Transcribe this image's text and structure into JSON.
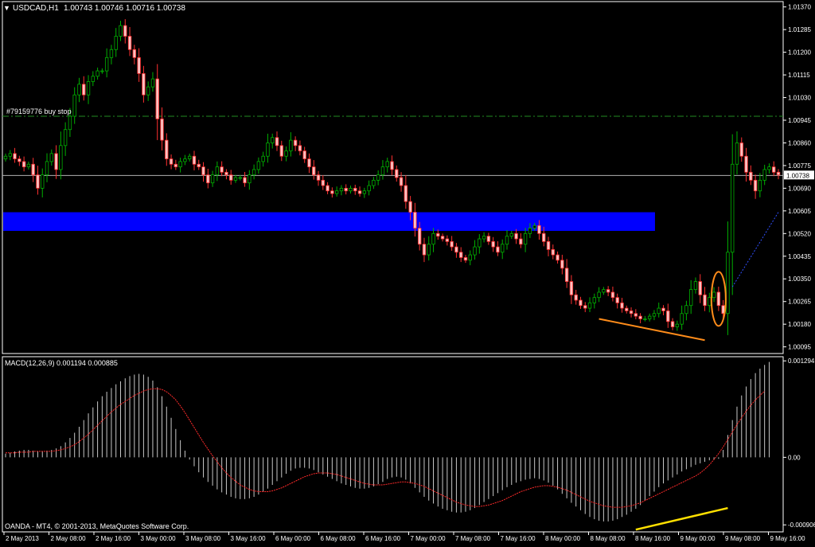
{
  "colors": {
    "background": "#000000",
    "frame": "#ffffff",
    "bull": "#00b000",
    "bear": "#ffc0c0",
    "bear_edge": "#ff3030",
    "zone": "#0000ff",
    "order_line": "#228b22",
    "bid_line": "#b0b0b0",
    "macd_hist": "#c8c8c8",
    "macd_signal": "#ff2a2a",
    "drawing_orange": "#ff8c1a",
    "drawing_yellow": "#ffe000",
    "trend_blue": "#3050ff"
  },
  "chart_data": [
    {
      "type": "candlestick",
      "title": "USDCAD,H1",
      "ohlc_header": "1.00743 1.00746 1.00716 1.00738",
      "menu_icon": "triangle-down-icon",
      "ylim": [
        1.0007,
        1.0139
      ],
      "y_ticks": [
        "1.01370",
        "1.01285",
        "1.01200",
        "1.01115",
        "1.01030",
        "1.00945",
        "1.00860",
        "1.00775",
        "1.00690",
        "1.00605",
        "1.00520",
        "1.00435",
        "1.00350",
        "1.00265",
        "1.00180",
        "1.00095"
      ],
      "current_price": "1.00738",
      "x_ticks": [
        "2 May 2013",
        "2 May 08:00",
        "2 May 16:00",
        "3 May 00:00",
        "3 May 08:00",
        "3 May 16:00",
        "6 May 00:00",
        "6 May 08:00",
        "6 May 16:00",
        "7 May 00:00",
        "7 May 08:00",
        "7 May 16:00",
        "8 May 00:00",
        "8 May 08:00",
        "8 May 16:00",
        "9 May 00:00",
        "9 May 08:00",
        "9 May 16:00"
      ],
      "pending_order": {
        "label": "#79159776 buy stop",
        "price": 1.0096
      },
      "support_zone": {
        "from": 1.0053,
        "to": 1.006,
        "start_bar": 0,
        "end_bar": 141
      },
      "close": [
        1.0081,
        1.0082,
        1.008,
        1.0079,
        1.0077,
        1.0078,
        1.0074,
        1.0069,
        1.0074,
        1.0079,
        1.0082,
        1.0076,
        1.0085,
        1.0091,
        1.0096,
        1.0104,
        1.0108,
        1.0104,
        1.0109,
        1.0111,
        1.0113,
        1.0113,
        1.0118,
        1.0121,
        1.0126,
        1.013,
        1.0126,
        1.0121,
        1.0118,
        1.0112,
        1.0104,
        1.0107,
        1.011,
        1.0095,
        1.0087,
        1.008,
        1.0078,
        1.0077,
        1.0079,
        1.008,
        1.0081,
        1.0078,
        1.0077,
        1.0074,
        1.0071,
        1.0074,
        1.0077,
        1.0075,
        1.0074,
        1.0072,
        1.0073,
        1.0073,
        1.0071,
        1.0074,
        1.0076,
        1.0079,
        1.0081,
        1.0086,
        1.0088,
        1.0085,
        1.0081,
        1.0083,
        1.0087,
        1.0085,
        1.0083,
        1.008,
        1.0077,
        1.0074,
        1.0072,
        1.007,
        1.0068,
        1.0067,
        1.0068,
        1.0069,
        1.0068,
        1.0069,
        1.0068,
        1.0067,
        1.0068,
        1.007,
        1.0072,
        1.0074,
        1.0077,
        1.0079,
        1.0076,
        1.0073,
        1.007,
        1.0064,
        1.006,
        1.0054,
        1.0048,
        1.0044,
        1.0048,
        1.0052,
        1.0051,
        1.005,
        1.0049,
        1.0047,
        1.0045,
        1.0043,
        1.0042,
        1.0044,
        1.0047,
        1.005,
        1.0051,
        1.0049,
        1.0047,
        1.0045,
        1.0048,
        1.0051,
        1.0052,
        1.005,
        1.0048,
        1.0052,
        1.0054,
        1.0055,
        1.0052,
        1.0049,
        1.0046,
        1.0044,
        1.0042,
        1.0039,
        1.0034,
        1.0029,
        1.0027,
        1.0025,
        1.0024,
        1.0026,
        1.0028,
        1.003,
        1.0031,
        1.003,
        1.0028,
        1.0026,
        1.0024,
        1.0023,
        1.0022,
        1.0021,
        1.002,
        1.002,
        1.0021,
        1.0022,
        1.0024,
        1.0023,
        1.0019,
        1.0017,
        1.0018,
        1.0022,
        1.0025,
        1.0031,
        1.0034,
        1.0029,
        1.0025,
        1.0028,
        1.003,
        1.0025,
        1.0022,
        1.0045,
        1.0078,
        1.0086,
        1.0081,
        1.0075,
        1.0072,
        1.0068,
        1.0072,
        1.0076,
        1.0077,
        1.0075,
        1.0074
      ]
    },
    {
      "type": "bar",
      "title": "MACD(12,26,9) 0.001194 0.000885",
      "ylim": [
        -0.001,
        0.00135
      ],
      "y_ticks": [
        "0.001294",
        "0.00",
        "-0.000906"
      ],
      "histogram": [
        5e-05,
        6e-05,
        8e-05,
        9e-05,
        0.0001,
        0.0001,
        9e-05,
        8e-05,
        8e-05,
        9e-05,
        0.0001,
        0.00012,
        0.00015,
        0.0002,
        0.00026,
        0.00033,
        0.00041,
        0.0005,
        0.00059,
        0.00067,
        0.00075,
        0.00082,
        0.00088,
        0.00093,
        0.00098,
        0.00102,
        0.00106,
        0.00109,
        0.00111,
        0.00112,
        0.00111,
        0.00108,
        0.00103,
        0.00094,
        0.00082,
        0.00068,
        0.00053,
        0.00038,
        0.00023,
        9e-05,
        -3e-05,
        -0.00012,
        -0.0002,
        -0.00027,
        -0.00033,
        -0.00038,
        -0.00043,
        -0.00047,
        -0.0005,
        -0.00053,
        -0.00055,
        -0.00056,
        -0.00056,
        -0.00055,
        -0.00053,
        -0.0005,
        -0.00046,
        -0.00042,
        -0.00037,
        -0.00032,
        -0.00027,
        -0.00022,
        -0.00018,
        -0.00015,
        -0.00014,
        -0.00014,
        -0.00015,
        -0.00017,
        -0.0002,
        -0.00023,
        -0.00026,
        -0.00029,
        -0.00032,
        -0.00035,
        -0.00037,
        -0.00039,
        -0.00041,
        -0.00042,
        -0.00042,
        -0.00041,
        -0.00039,
        -0.00036,
        -0.00033,
        -0.00029,
        -0.00027,
        -0.00026,
        -0.00027,
        -0.0003,
        -0.00035,
        -0.00041,
        -0.00047,
        -0.00053,
        -0.00058,
        -0.00062,
        -0.00066,
        -0.00069,
        -0.00071,
        -0.00073,
        -0.00074,
        -0.00074,
        -0.00073,
        -0.00071,
        -0.00068,
        -0.00064,
        -0.0006,
        -0.00056,
        -0.00052,
        -0.00048,
        -0.00044,
        -0.0004,
        -0.00037,
        -0.00034,
        -0.00032,
        -0.0003,
        -0.00029,
        -0.00028,
        -0.00029,
        -0.00031,
        -0.00034,
        -0.00038,
        -0.00043,
        -0.00049,
        -0.00055,
        -0.00061,
        -0.00066,
        -0.00071,
        -0.00076,
        -0.0008,
        -0.00083,
        -0.00085,
        -0.00086,
        -0.00086,
        -0.00085,
        -0.00083,
        -0.0008,
        -0.00077,
        -0.00073,
        -0.00069,
        -0.00064,
        -0.00058,
        -0.00052,
        -0.00046,
        -0.0004,
        -0.00035,
        -0.00031,
        -0.00027,
        -0.00023,
        -0.00019,
        -0.00016,
        -0.00013,
        -0.0001,
        -8e-05,
        -6e-05,
        -4e-05,
        -3e-05,
        -2e-05,
        0.0001,
        0.0003,
        0.0005,
        0.00068,
        0.00083,
        0.00095,
        0.00105,
        0.00113,
        0.00119,
        0.00124,
        0.00128
      ],
      "signal": [
        6e-05,
        6e-05,
        6e-05,
        7e-05,
        7e-05,
        7e-05,
        8e-05,
        8e-05,
        8e-05,
        8e-05,
        8e-05,
        9e-05,
        0.0001,
        0.00012,
        0.00014,
        0.00017,
        0.00021,
        0.00026,
        0.00031,
        0.00037,
        0.00043,
        0.00049,
        0.00055,
        0.00061,
        0.00066,
        0.00071,
        0.00075,
        0.00079,
        0.00083,
        0.00086,
        0.00089,
        0.00091,
        0.00092,
        0.00092,
        0.00091,
        0.00088,
        0.00083,
        0.00077,
        0.00069,
        0.0006,
        0.0005,
        0.0004,
        0.0003,
        0.0002,
        0.00011,
        2e-05,
        -6e-05,
        -0.00014,
        -0.00021,
        -0.00027,
        -0.00032,
        -0.00037,
        -0.0004,
        -0.00043,
        -0.00045,
        -0.00046,
        -0.00046,
        -0.00046,
        -0.00045,
        -0.00043,
        -0.00041,
        -0.00038,
        -0.00035,
        -0.00032,
        -0.00029,
        -0.00026,
        -0.00024,
        -0.00022,
        -0.00021,
        -0.00021,
        -0.00021,
        -0.00022,
        -0.00023,
        -0.00025,
        -0.00027,
        -0.00029,
        -0.00031,
        -0.00033,
        -0.00035,
        -0.00036,
        -0.00037,
        -0.00037,
        -0.00037,
        -0.00036,
        -0.00035,
        -0.00034,
        -0.00033,
        -0.00033,
        -0.00034,
        -0.00035,
        -0.00037,
        -0.00039,
        -0.00042,
        -0.00045,
        -0.00048,
        -0.00051,
        -0.00054,
        -0.00057,
        -0.0006,
        -0.00062,
        -0.00064,
        -0.00065,
        -0.00066,
        -0.00066,
        -0.00065,
        -0.00064,
        -0.00062,
        -0.0006,
        -0.00058,
        -0.00055,
        -0.00052,
        -0.00049,
        -0.00046,
        -0.00044,
        -0.00042,
        -0.0004,
        -0.00039,
        -0.00038,
        -0.00038,
        -0.00039,
        -0.0004,
        -0.00042,
        -0.00044,
        -0.00047,
        -0.0005,
        -0.00053,
        -0.00056,
        -0.00059,
        -0.00061,
        -0.00063,
        -0.00065,
        -0.00066,
        -0.00067,
        -0.00067,
        -0.00067,
        -0.00066,
        -0.00065,
        -0.00063,
        -0.00061,
        -0.00058,
        -0.00055,
        -0.00052,
        -0.00049,
        -0.00046,
        -0.00043,
        -0.0004,
        -0.00037,
        -0.00034,
        -0.00031,
        -0.00028,
        -0.00025,
        -0.00021,
        -0.00016,
        -0.0001,
        -3e-05,
        5e-05,
        0.00014,
        0.00024,
        0.00034,
        0.00044,
        0.00053,
        0.00062,
        0.0007,
        0.00077,
        0.00083,
        0.00089
      ]
    }
  ],
  "footer": {
    "copyright": "OANDA - MT4, © 2001-2013, MetaQuotes Software Corp."
  },
  "drawings": {
    "price_ellipse_bar": 155,
    "price_trendline": {
      "from_bar": 129,
      "from_price": 1.002,
      "to_bar": 152,
      "to_price": 1.0012
    },
    "macd_trendline": {
      "from_bar": 137,
      "from_value": -0.00097,
      "to_bar": 157,
      "to_value": -0.00068
    },
    "blue_dotted": {
      "from_bar": 158,
      "from_price": 1.0032,
      "to_bar": 168,
      "to_price": 1.006
    }
  }
}
